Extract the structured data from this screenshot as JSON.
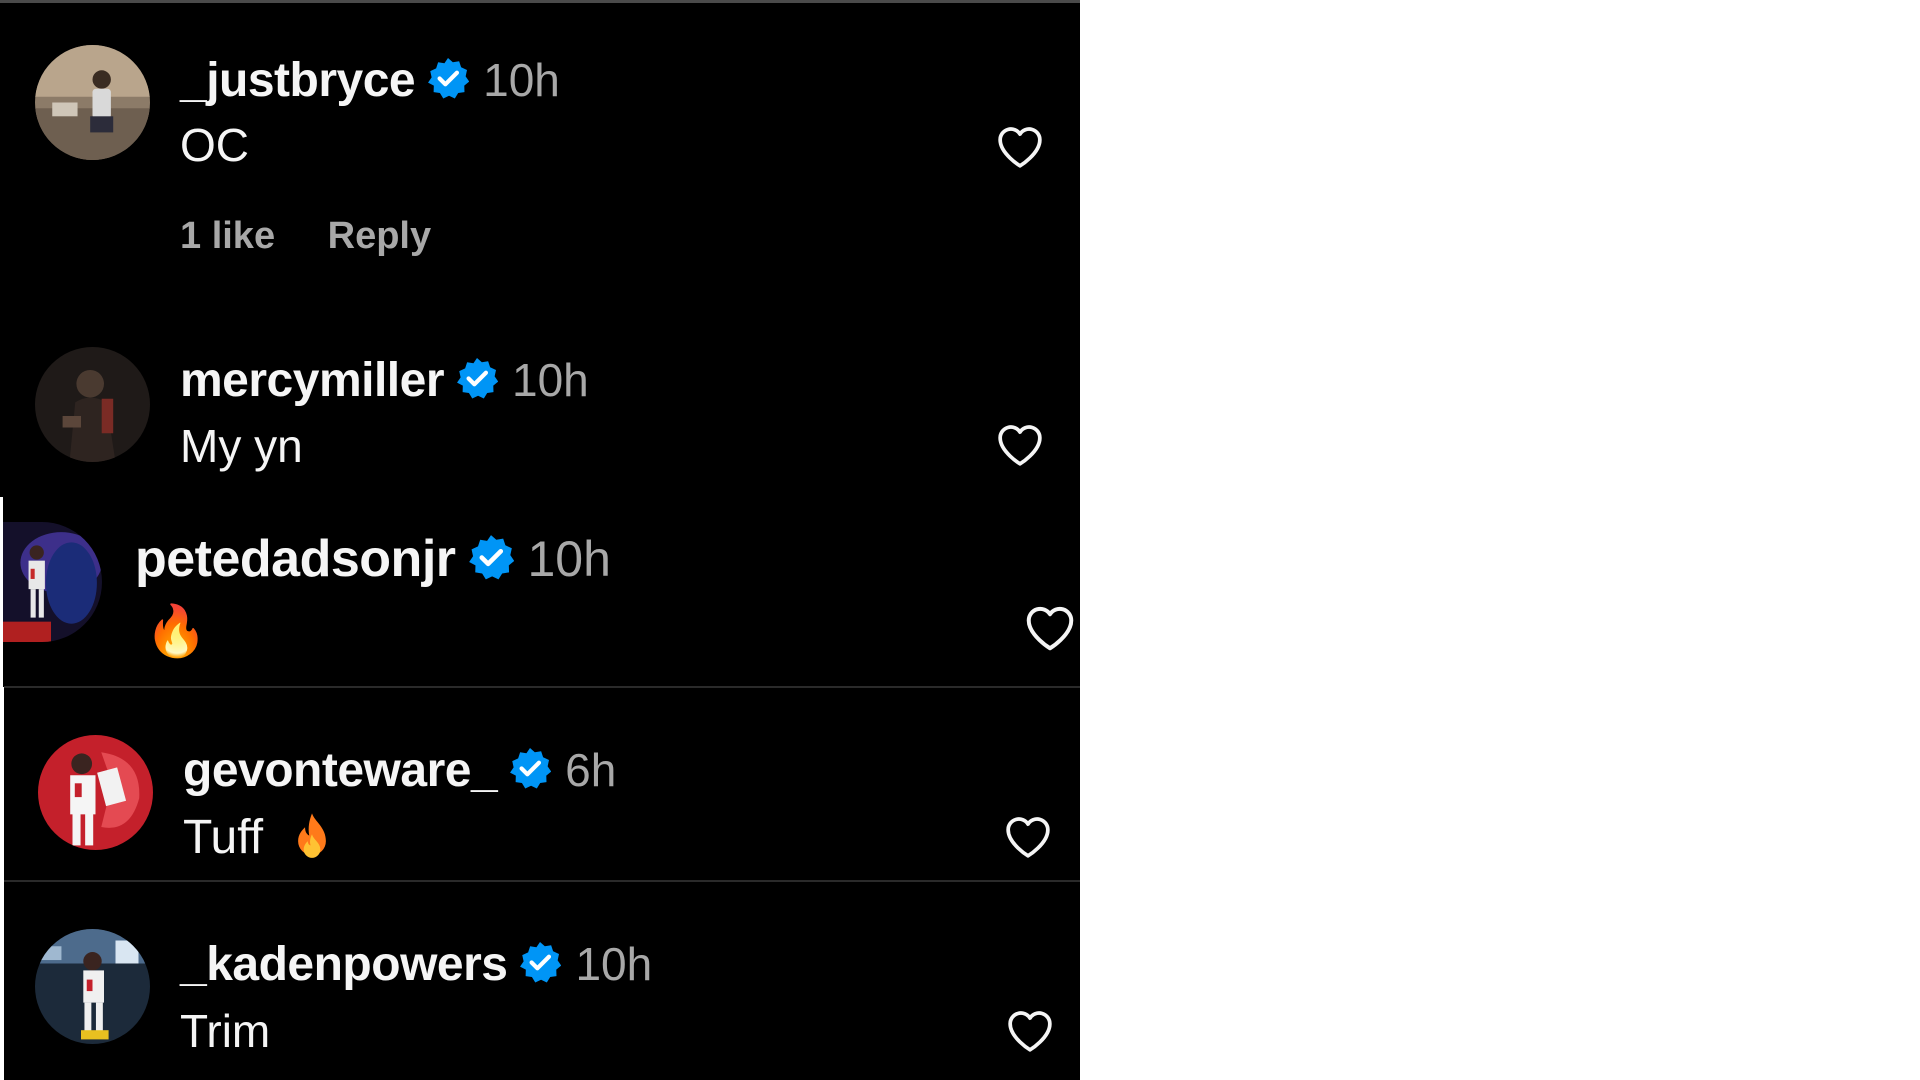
{
  "accent": {
    "verified": "#0095f6",
    "fire": "#ff6a00"
  },
  "icons": {
    "verified": "verified-badge-icon",
    "like": "heart-outline-icon",
    "emoji": "fire-emoji-icon"
  },
  "comments": [
    {
      "username": "_justbryce",
      "time": "10h",
      "text": "OC",
      "likes_label": "1 like",
      "reply_label": "Reply"
    },
    {
      "username": "mercymiller",
      "time": "10h",
      "text": "My yn"
    },
    {
      "username": "petedadsonjr",
      "time": "10h",
      "text": "🔥"
    },
    {
      "username": "gevonteware_",
      "time": "6h",
      "text": "Tuff"
    },
    {
      "username": "_kadenpowers",
      "time": "10h",
      "text": "Trim"
    }
  ]
}
